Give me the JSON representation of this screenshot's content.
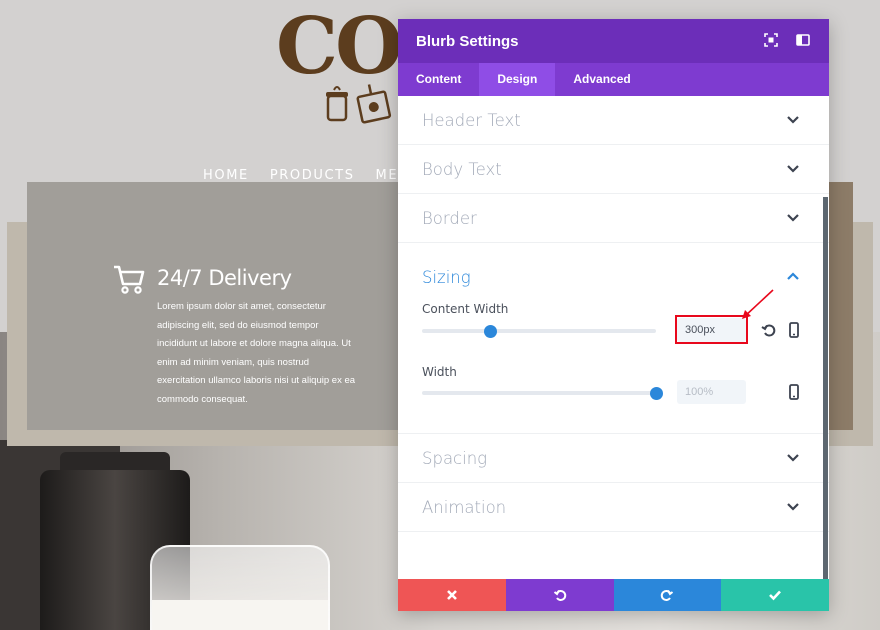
{
  "site": {
    "logo_text": "CO",
    "nav": [
      "HOME",
      "PRODUCTS",
      "MEN"
    ],
    "blurb": {
      "title": "24/7 Delivery",
      "body": "Lorem ipsum dolor sit amet, consectetur adipiscing elit, sed do eiusmod tempor incididunt ut labore et dolore magna aliqua. Ut enim ad minim veniam, quis nostrud exercitation ullamco laboris nisi ut aliquip ex ea commodo consequat.",
      "icon": "shopping-cart-icon"
    }
  },
  "modal": {
    "title": "Blurb Settings",
    "header_icons": [
      "expand-icon",
      "split-view-icon"
    ],
    "tabs": [
      {
        "label": "Content",
        "active": false
      },
      {
        "label": "Design",
        "active": true
      },
      {
        "label": "Advanced",
        "active": false
      }
    ],
    "sections_before": [
      "Header Text",
      "Body Text",
      "Border"
    ],
    "sizing": {
      "label": "Sizing",
      "expanded": true,
      "content_width": {
        "label": "Content Width",
        "value": "300px",
        "slider_percent": 29
      },
      "width": {
        "label": "Width",
        "placeholder": "100%",
        "slider_percent": 100
      }
    },
    "sections_after": [
      "Spacing",
      "Animation"
    ],
    "footer": [
      "discard-icon",
      "undo-icon",
      "redo-icon",
      "save-check-icon"
    ]
  },
  "colors": {
    "header": "#6c2eb9",
    "tabs": "#7e3bd0",
    "accent_blue": "#2b87da",
    "discard": "#ef5555",
    "save": "#29c4a9",
    "annotation": "#e8081c"
  }
}
